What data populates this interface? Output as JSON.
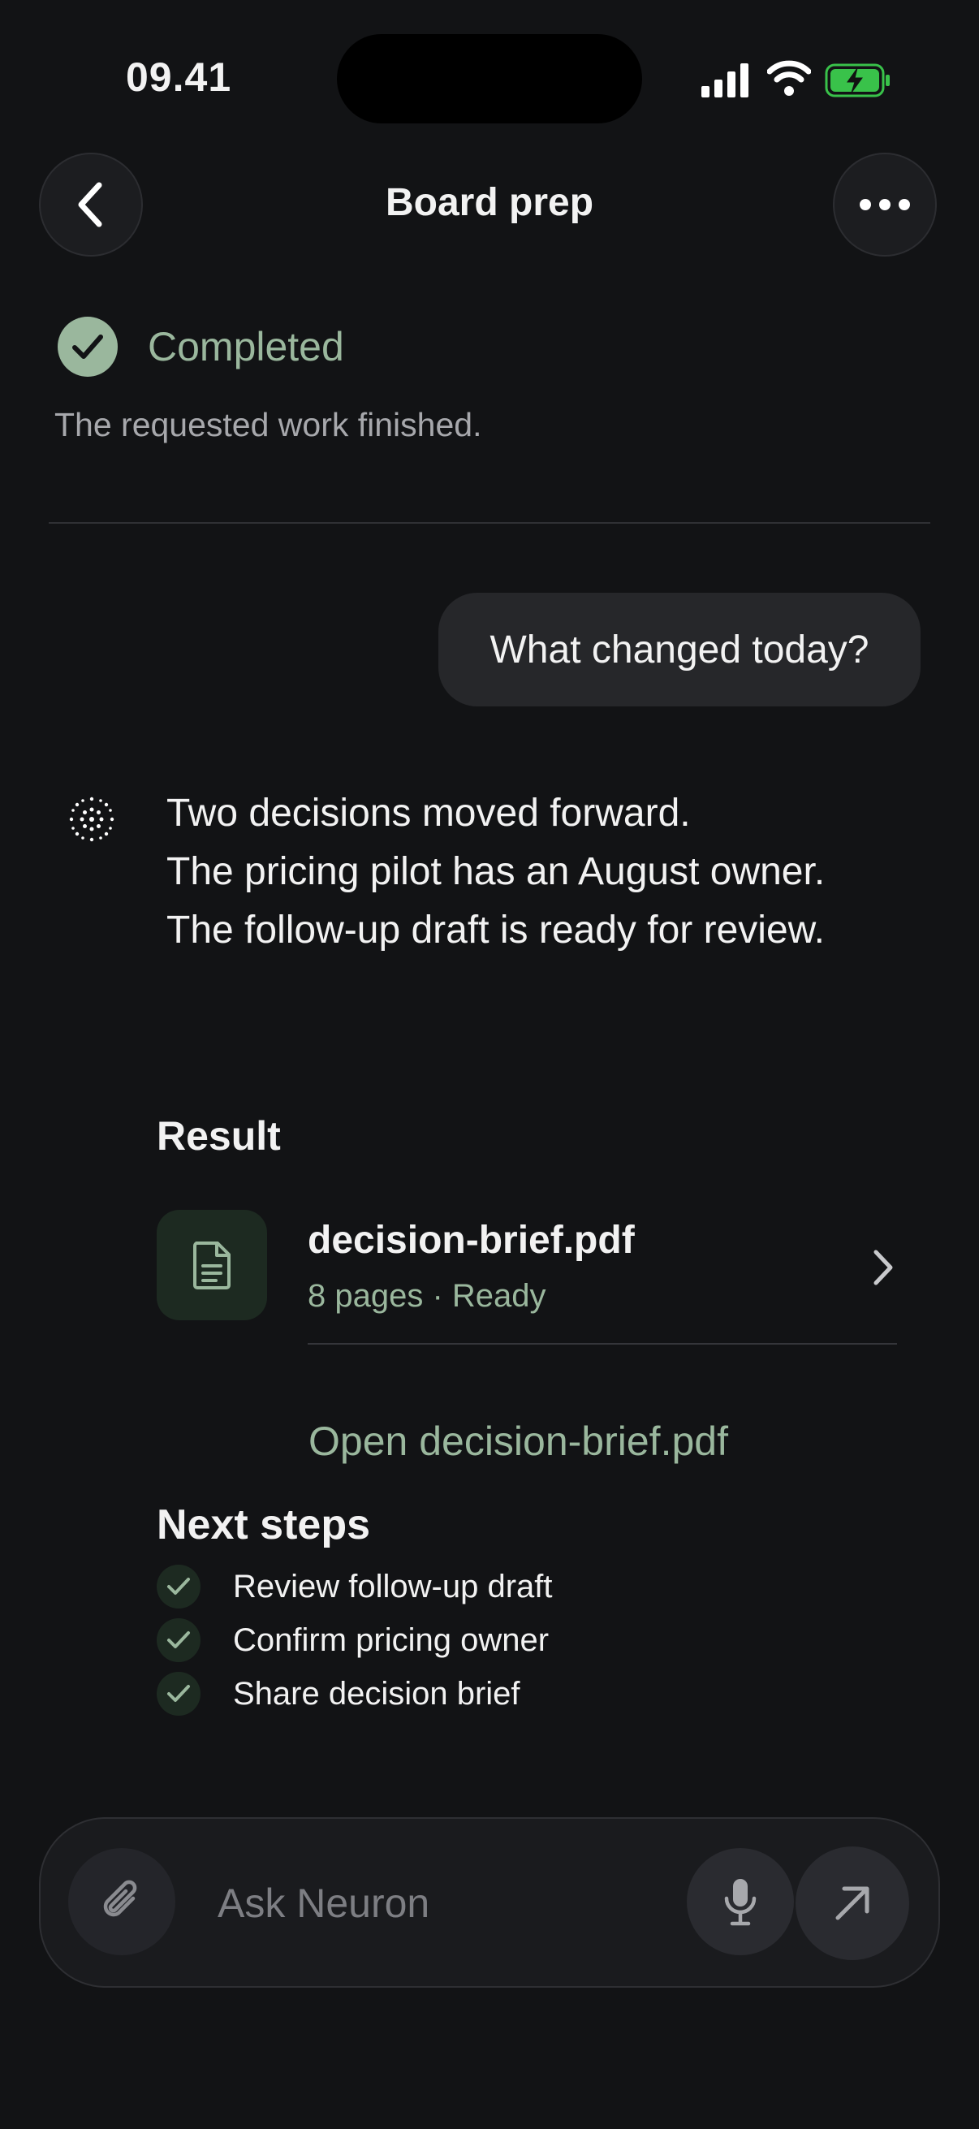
{
  "status_bar": {
    "time": "09.41"
  },
  "header": {
    "title": "Board prep",
    "back_icon": "chevron-left-icon",
    "more_icon": "ellipsis-icon"
  },
  "task_status": {
    "label": "Completed",
    "description": "The requested work finished.",
    "icon": "check-circle-icon",
    "accent_color": "#9ab79d"
  },
  "conversation": {
    "user_message": "What changed today?",
    "assistant_lines": [
      "Two decisions moved forward.",
      "The pricing pilot has an August owner.",
      "The follow-up draft is ready for review."
    ]
  },
  "result": {
    "heading": "Result",
    "file": {
      "name": "decision-brief.pdf",
      "meta": "8 pages · Ready",
      "icon": "document-icon"
    },
    "open_link": "Open decision-brief.pdf"
  },
  "next_steps": {
    "heading": "Next steps",
    "items": [
      "Review follow-up draft",
      "Confirm pricing owner",
      "Share decision brief"
    ]
  },
  "composer": {
    "placeholder": "Ask Neuron"
  },
  "colors": {
    "background": "#121315",
    "accent": "#9ab79d",
    "battery_green": "#39c24a"
  }
}
